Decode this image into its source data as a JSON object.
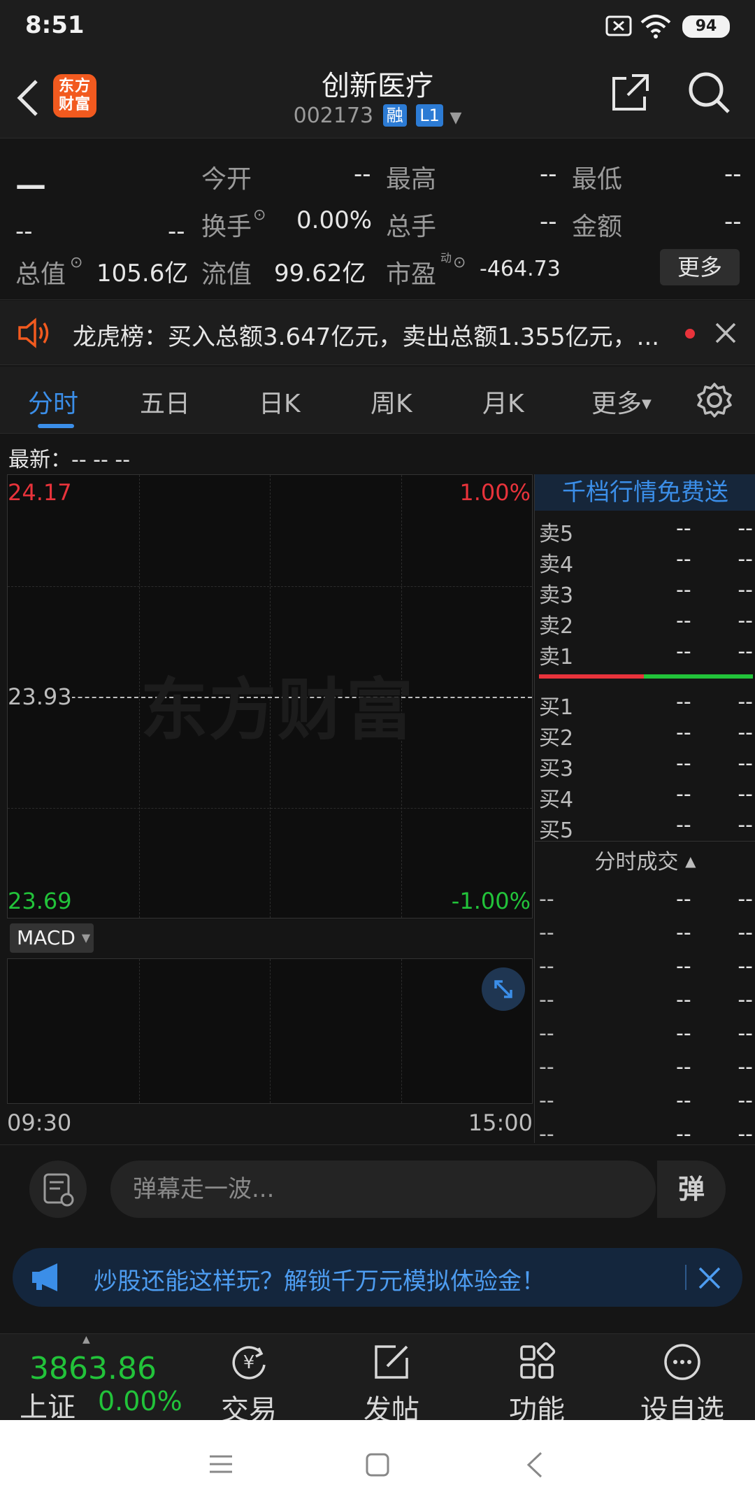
{
  "status_bar": {
    "time": "8:51",
    "battery": "94"
  },
  "header": {
    "stock_name": "创新医疗",
    "stock_code": "002173",
    "tag_margin": "融",
    "tag_level": "L1",
    "logo_text_1": "东方",
    "logo_text_2": "财富"
  },
  "quote": {
    "price": "—",
    "change": "--",
    "change_pct": "--",
    "open_label": "今开",
    "open_value": "--",
    "high_label": "最高",
    "high_value": "--",
    "low_label": "最低",
    "low_value": "--",
    "turnover_label": "换手",
    "turnover_value": "0.00%",
    "volume_label": "总手",
    "volume_value": "--",
    "amount_label": "金额",
    "amount_value": "--",
    "mcap_label": "总值",
    "mcap_value": "105.6亿",
    "float_label": "流值",
    "float_value": "99.62亿",
    "pe_label": "市盈",
    "pe_sup": "动",
    "pe_value": "-464.73",
    "more_button": "更多"
  },
  "notice": {
    "text": "龙虎榜：买入总额3.647亿元，卖出总额1.355亿元，..."
  },
  "tabs": [
    {
      "label": "分时"
    },
    {
      "label": "五日"
    },
    {
      "label": "日K"
    },
    {
      "label": "周K"
    },
    {
      "label": "月K"
    },
    {
      "label": "更多"
    }
  ],
  "latest": {
    "text": "最新：--  --  --"
  },
  "chart": {
    "upper_price": "24.17",
    "upper_pct": "1.00%",
    "mid_price": "23.93",
    "lower_price": "23.69",
    "lower_pct": "-1.00%",
    "watermark": "东方财富",
    "start_time": "09:30",
    "end_time": "15:00"
  },
  "macd": {
    "label": "MACD"
  },
  "order_book": {
    "banner": "千档行情免费送",
    "sells": [
      {
        "label": "卖5",
        "price": "--",
        "vol": "--"
      },
      {
        "label": "卖4",
        "price": "--",
        "vol": "--"
      },
      {
        "label": "卖3",
        "price": "--",
        "vol": "--"
      },
      {
        "label": "卖2",
        "price": "--",
        "vol": "--"
      },
      {
        "label": "卖1",
        "price": "--",
        "vol": "--"
      }
    ],
    "buys": [
      {
        "label": "买1",
        "price": "--",
        "vol": "--"
      },
      {
        "label": "买2",
        "price": "--",
        "vol": "--"
      },
      {
        "label": "买3",
        "price": "--",
        "vol": "--"
      },
      {
        "label": "买4",
        "price": "--",
        "vol": "--"
      },
      {
        "label": "买5",
        "price": "--",
        "vol": "--"
      }
    ],
    "trades_header": "分时成交",
    "trades": [
      {
        "time": "--",
        "price": "--",
        "vol": "--"
      },
      {
        "time": "--",
        "price": "--",
        "vol": "--"
      },
      {
        "time": "--",
        "price": "--",
        "vol": "--"
      },
      {
        "time": "--",
        "price": "--",
        "vol": "--"
      },
      {
        "time": "--",
        "price": "--",
        "vol": "--"
      },
      {
        "time": "--",
        "price": "--",
        "vol": "--"
      },
      {
        "time": "--",
        "price": "--",
        "vol": "--"
      },
      {
        "time": "--",
        "price": "--",
        "vol": "--"
      }
    ]
  },
  "danmaku": {
    "placeholder": "弹幕走一波...",
    "send": "弹"
  },
  "ad": {
    "text": "炒股还能这样玩？解锁千万元模拟体验金！"
  },
  "bottom_nav": {
    "index_value": "3863.86",
    "index_name": "上证",
    "index_pct": "0.00%",
    "items": [
      {
        "label": "交易"
      },
      {
        "label": "发帖"
      },
      {
        "label": "功能"
      },
      {
        "label": "设自选"
      }
    ]
  },
  "colors": {
    "up": "#e8333b",
    "down": "#22c33a",
    "accent": "#3b8ee8",
    "brand": "#f25a1f"
  }
}
